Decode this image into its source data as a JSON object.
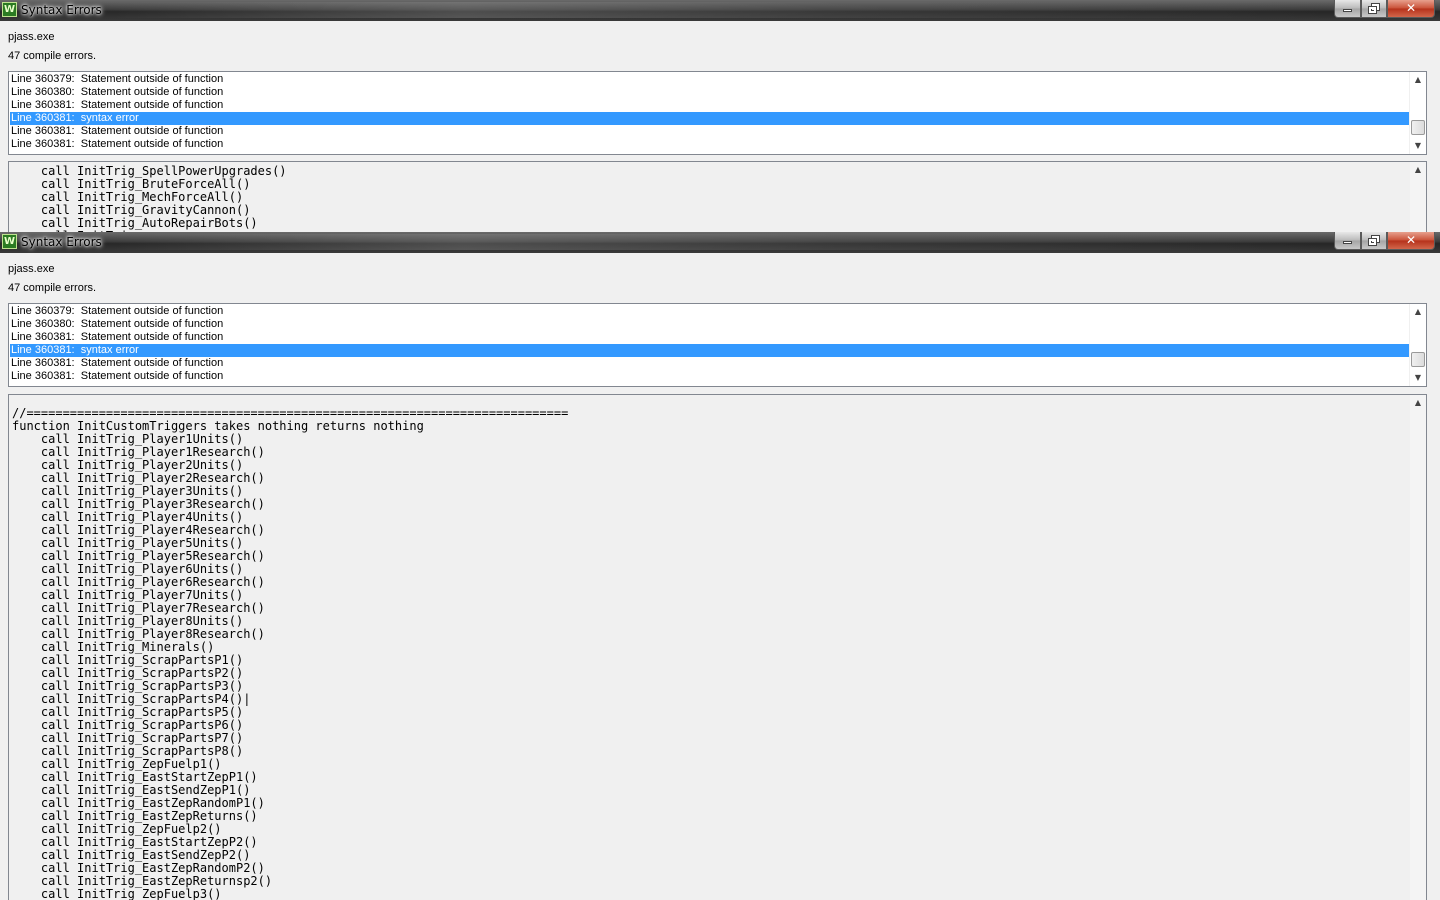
{
  "window_top": {
    "title": "Syntax Errors",
    "app_icon_letter": "W",
    "exe": "pjass.exe",
    "error_count": "47 compile errors.",
    "errors": [
      "Line 360379:  Statement outside of function",
      "Line 360380:  Statement outside of function",
      "Line 360381:  Statement outside of function",
      "Line 360381:  syntax error",
      "Line 360381:  Statement outside of function",
      "Line 360381:  Statement outside of function"
    ],
    "selected_error_index": 3,
    "code": [
      "    call InitTrig_SpellPowerUpgrades()",
      "    call InitTrig_BruteForceAll()",
      "    call InitTrig_MechForceAll()",
      "    call InitTrig_GravityCannon()",
      "    call InitTrig_AutoRepairBots()",
      "    call InitTrig_..."
    ]
  },
  "window_bottom": {
    "title": "Syntax Errors",
    "app_icon_letter": "W",
    "exe": "pjass.exe",
    "error_count": "47 compile errors.",
    "errors": [
      "Line 360379:  Statement outside of function",
      "Line 360380:  Statement outside of function",
      "Line 360381:  Statement outside of function",
      "Line 360381:  syntax error",
      "Line 360381:  Statement outside of function",
      "Line 360381:  Statement outside of function"
    ],
    "selected_error_index": 3,
    "code": [
      "//===========================================================================",
      "function InitCustomTriggers takes nothing returns nothing",
      "    call InitTrig_Player1Units()",
      "    call InitTrig_Player1Research()",
      "    call InitTrig_Player2Units()",
      "    call InitTrig_Player2Research()",
      "    call InitTrig_Player3Units()",
      "    call InitTrig_Player3Research()",
      "    call InitTrig_Player4Units()",
      "    call InitTrig_Player4Research()",
      "    call InitTrig_Player5Units()",
      "    call InitTrig_Player5Research()",
      "    call InitTrig_Player6Units()",
      "    call InitTrig_Player6Research()",
      "    call InitTrig_Player7Units()",
      "    call InitTrig_Player7Research()",
      "    call InitTrig_Player8Units()",
      "    call InitTrig_Player8Research()",
      "    call InitTrig_Minerals()",
      "    call InitTrig_ScrapPartsP1()",
      "    call InitTrig_ScrapPartsP2()",
      "    call InitTrig_ScrapPartsP3()",
      "    call InitTrig_ScrapPartsP4()|",
      "    call InitTrig_ScrapPartsP5()",
      "    call InitTrig_ScrapPartsP6()",
      "    call InitTrig_ScrapPartsP7()",
      "    call InitTrig_ScrapPartsP8()",
      "    call InitTrig_ZepFuelp1()",
      "    call InitTrig_EastStartZepP1()",
      "    call InitTrig_EastSendZepP1()",
      "    call InitTrig_EastZepRandomP1()",
      "    call InitTrig_EastZepReturns()",
      "    call InitTrig_ZepFuelp2()",
      "    call InitTrig_EastStartZepP2()",
      "    call InitTrig_EastSendZepP2()",
      "    call InitTrig_EastZepRandomP2()",
      "    call InitTrig_EastZepReturnsp2()",
      "    call InitTrig_ZepFuelp3()"
    ]
  },
  "controls": {
    "close_glyph": "✕",
    "scroll_up_glyph": "▲",
    "scroll_down_glyph": "▼"
  },
  "colors": {
    "selection": "#3399ff",
    "window_bg": "#f0f0f0",
    "close_button": "#c94f36"
  }
}
